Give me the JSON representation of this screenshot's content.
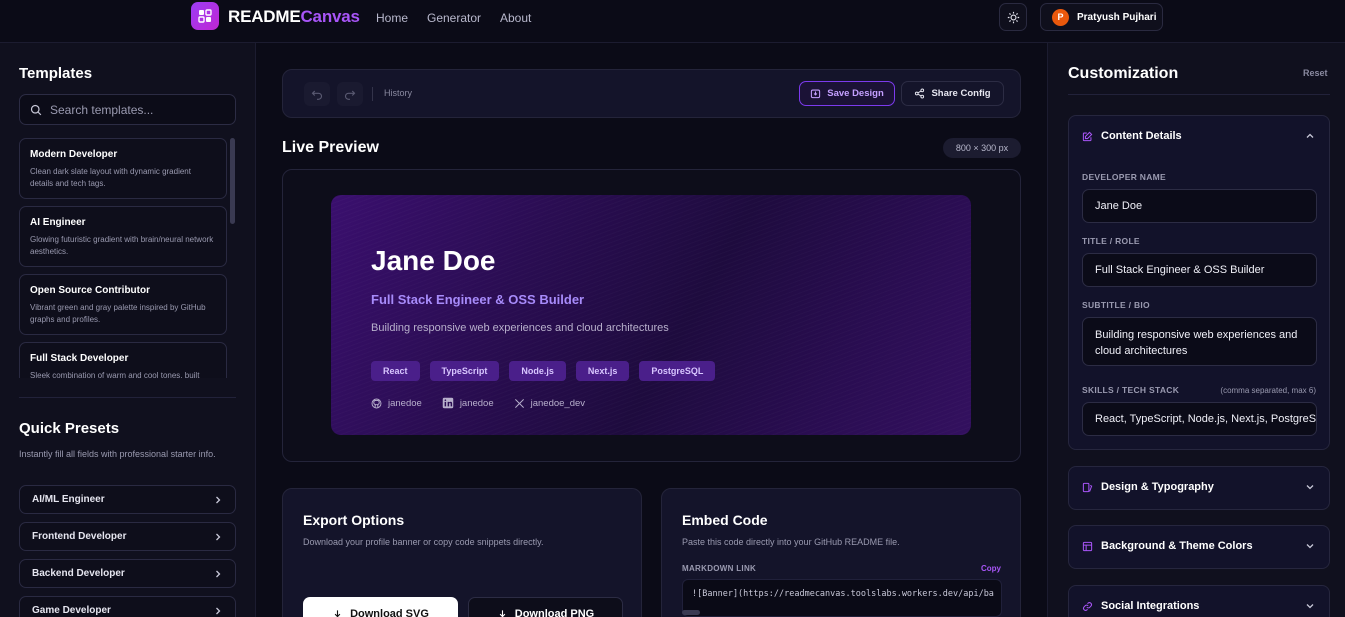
{
  "nav": {
    "brand_a": "README",
    "brand_b": "Canvas",
    "links": [
      "Home",
      "Generator",
      "About"
    ],
    "user_initial": "P",
    "user_name": "Pratyush Pujhari"
  },
  "left": {
    "templates_title": "Templates",
    "search_placeholder": "Search templates...",
    "templates": [
      {
        "name": "Modern Developer",
        "desc": "Clean dark slate layout with dynamic gradient details and tech tags."
      },
      {
        "name": "AI Engineer",
        "desc": "Glowing futuristic gradient with brain/neural network aesthetics."
      },
      {
        "name": "Open Source Contributor",
        "desc": "Vibrant green and gray palette inspired by GitHub graphs and profiles."
      },
      {
        "name": "Full Stack Developer",
        "desc": "Sleek combination of warm and cool tones, built"
      }
    ],
    "presets_title": "Quick Presets",
    "presets_sub": "Instantly fill all fields with professional starter info.",
    "presets": [
      "AI/ML Engineer",
      "Frontend Developer",
      "Backend Developer",
      "Game Developer"
    ]
  },
  "toolbar": {
    "history": "History",
    "save": "Save Design",
    "share": "Share Config"
  },
  "preview": {
    "title": "Live Preview",
    "dims": "800 × 300 px",
    "banner": {
      "name": "Jane Doe",
      "role": "Full Stack Engineer & OSS Builder",
      "bio": "Building responsive web experiences and cloud architectures",
      "tags": [
        "React",
        "TypeScript",
        "Node.js",
        "Next.js",
        "PostgreSQL"
      ],
      "github": "janedoe",
      "linkedin": "janedoe",
      "x": "janedoe_dev"
    }
  },
  "export": {
    "title": "Export Options",
    "sub": "Download your profile banner or copy code snippets directly.",
    "svg": "Download SVG",
    "png": "Download PNG"
  },
  "embed": {
    "title": "Embed Code",
    "sub": "Paste this code directly into your GitHub README file.",
    "label": "MARKDOWN LINK",
    "copy": "Copy",
    "code": "![Banner](https://readmecanvas.toolslabs.workers.dev/api/ba"
  },
  "custom": {
    "title": "Customization",
    "reset": "Reset",
    "content_title": "Content Details",
    "name_label": "DEVELOPER NAME",
    "name_value": "Jane Doe",
    "role_label": "TITLE / ROLE",
    "role_value": "Full Stack Engineer & OSS Builder",
    "bio_label": "SUBTITLE / BIO",
    "bio_value": "Building responsive web experiences and cloud architectures",
    "skills_label": "SKILLS / TECH STACK",
    "skills_note": "(comma separated, max 6)",
    "skills_value": "React, TypeScript, Node.js, Next.js, PostgreSQL",
    "design_title": "Design & Typography",
    "bg_title": "Background & Theme Colors",
    "social_title": "Social Integrations"
  },
  "colors": {
    "accent": "#a855f7",
    "background": "#0b0b17",
    "panel": "#10101e"
  }
}
